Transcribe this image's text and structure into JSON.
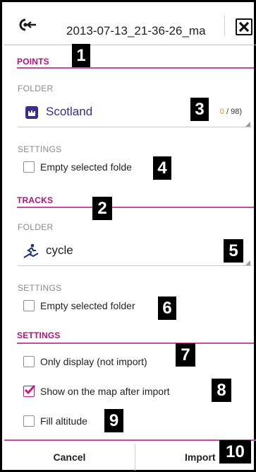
{
  "header": {
    "title": "2013-07-13_21-36-26_ma",
    "back_icon": "import-back-icon",
    "close_icon": "close-x-icon"
  },
  "points": {
    "section_label": "POINTS",
    "folder_label": "FOLDER",
    "folder_name": "Scotland",
    "folder_icon": "folder-castle-icon",
    "count_prefix": "0",
    "count_suffix": " / 98)",
    "settings_label": "SETTINGS",
    "empty_folder_label": "Empty selected folde",
    "empty_folder_checked": false
  },
  "tracks": {
    "section_label": "TRACKS",
    "folder_label": "FOLDER",
    "folder_name": "cycle",
    "folder_icon": "cyclist-icon",
    "count_text": "(",
    "settings_label": "SETTINGS",
    "empty_folder_label": "Empty selected folder",
    "empty_folder_checked": false
  },
  "settings": {
    "section_label": "SETTINGS",
    "only_display_label": "Only display (not import)",
    "only_display_checked": false,
    "show_on_map_label": "Show on the map after import",
    "show_on_map_checked": true,
    "fill_altitude_label": "Fill altitude",
    "fill_altitude_checked": false
  },
  "footer": {
    "cancel_label": "Cancel",
    "import_label": "Import"
  },
  "badges": [
    "1",
    "2",
    "3",
    "4",
    "5",
    "6",
    "7",
    "8",
    "9",
    "10"
  ],
  "colors": {
    "accent": "#b0157a",
    "accent_line": "#c74b9f",
    "folder_text": "#303090",
    "count_orange": "#e08a1e",
    "badge_bg": "#000000"
  }
}
